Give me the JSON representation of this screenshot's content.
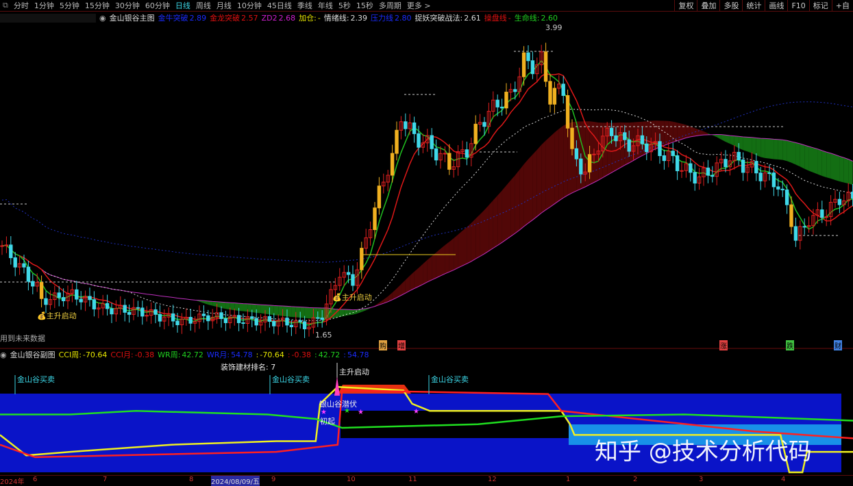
{
  "toolbar": {
    "periods": [
      "分时",
      "1分钟",
      "5分钟",
      "15分钟",
      "30分钟",
      "60分钟",
      "日线",
      "周线",
      "月线",
      "10分钟",
      "45日线",
      "季线",
      "年线",
      "5秒",
      "15秒",
      "多周期",
      "更多 >"
    ],
    "active_period": "日线",
    "right_buttons": [
      "复权",
      "叠加",
      "多股",
      "统计",
      "画线",
      "F10",
      "标记",
      "+自"
    ]
  },
  "main_legend": {
    "title": "金山银谷主图",
    "items": [
      {
        "label": "金牛突破",
        "value": "2.89",
        "color": "#1a2cff"
      },
      {
        "label": "金龙突破",
        "value": "2.57",
        "color": "#e01010"
      },
      {
        "label": "ZD2",
        "value": "2.68",
        "color": "#d020d0"
      },
      {
        "label": "加仓:",
        "value": "-",
        "color": "#e8e800"
      },
      {
        "label": "情绪线:",
        "value": "2.39",
        "color": "#ddd"
      },
      {
        "label": "压力线",
        "value": "2.80",
        "color": "#1a2cff"
      },
      {
        "label": "捉妖突破战法:",
        "value": "2.61",
        "color": "#ddd"
      },
      {
        "label": "操盘线",
        "value": "-",
        "color": "#e01010"
      },
      {
        "label": "生命线:",
        "value": "2.60",
        "color": "#20d020"
      }
    ]
  },
  "main_annotations": {
    "high": "3.99",
    "low": "1.65",
    "signal1": "主升启动",
    "signal2": "主升启动",
    "warning": "用到未来数据"
  },
  "badges": [
    {
      "text": "购",
      "color": "#e0a040"
    },
    {
      "text": "增",
      "color": "#e04040"
    },
    {
      "text": "涨",
      "color": "#e04040"
    },
    {
      "text": "跌",
      "color": "#40c040"
    },
    {
      "text": "财",
      "color": "#4080e0"
    }
  ],
  "sub_legend": {
    "title": "金山银谷副图",
    "items": [
      {
        "label": "CCI周:",
        "value": "-70.64",
        "color": "#e8e800"
      },
      {
        "label": "CCI月:",
        "value": "-0.38",
        "color": "#e01010"
      },
      {
        "label": "WR周:",
        "value": "42.72",
        "color": "#20d020"
      },
      {
        "label": "WR月:",
        "value": "54.78",
        "color": "#1a2cff"
      },
      {
        "label": ":",
        "value": "-70.64",
        "color": "#e8e800"
      },
      {
        "label": ":",
        "value": "-0.38",
        "color": "#e01010"
      },
      {
        "label": ":",
        "value": "42.72",
        "color": "#20d020"
      },
      {
        "label": ":",
        "value": "54.78",
        "color": "#1a2cff"
      }
    ],
    "rank": "装饰建材排名: 7",
    "buy_sell": "金山谷买卖",
    "start": "主升启动",
    "latent": "银山谷潜伏",
    "initial": "初起",
    "gold_valley": "金山谷买卖"
  },
  "x_axis": {
    "labels": [
      "2024年",
      "6",
      "7",
      "8",
      "2024/08/09/五",
      "9",
      "10",
      "11",
      "12",
      "1",
      "2",
      "3",
      "4"
    ]
  },
  "watermark": "知乎 @技术分析代码",
  "chart_data": {
    "type": "candlestick",
    "price_range": [
      1.65,
      3.99
    ],
    "close_waypoints": [
      [
        0,
        2.32
      ],
      [
        8,
        2.0
      ],
      [
        9,
        1.9
      ],
      [
        16,
        1.95
      ],
      [
        23,
        1.84
      ],
      [
        31,
        1.82
      ],
      [
        41,
        1.74
      ],
      [
        47,
        1.78
      ],
      [
        55,
        1.75
      ],
      [
        63,
        1.74
      ],
      [
        70,
        1.71
      ],
      [
        73,
        1.79
      ],
      [
        77,
        2.11
      ],
      [
        80,
        2.05
      ],
      [
        83,
        2.37
      ],
      [
        86,
        2.73
      ],
      [
        89,
        3.0
      ],
      [
        91,
        3.31
      ],
      [
        94,
        3.15
      ],
      [
        97,
        3.1
      ],
      [
        102,
        2.94
      ],
      [
        106,
        3.05
      ],
      [
        109,
        3.26
      ],
      [
        113,
        3.41
      ],
      [
        116,
        3.47
      ],
      [
        119,
        3.73
      ],
      [
        122,
        3.7
      ],
      [
        123,
        3.73
      ],
      [
        125,
        3.47
      ],
      [
        128,
        3.52
      ],
      [
        130,
        3.0
      ],
      [
        133,
        2.89
      ],
      [
        136,
        3.1
      ],
      [
        139,
        3.2
      ],
      [
        142,
        3.1
      ],
      [
        147,
        3.1
      ],
      [
        152,
        3.0
      ],
      [
        156,
        2.89
      ],
      [
        159,
        2.84
      ],
      [
        164,
        2.94
      ],
      [
        166,
        3.0
      ],
      [
        169,
        2.94
      ],
      [
        172,
        2.89
      ],
      [
        177,
        2.79
      ],
      [
        180,
        2.52
      ],
      [
        181,
        2.37
      ],
      [
        184,
        2.52
      ],
      [
        188,
        2.58
      ],
      [
        191,
        2.68
      ]
    ],
    "sub_series": [
      {
        "name": "CCI周",
        "color": "#f0f020",
        "points": [
          [
            0,
            42
          ],
          [
            6,
            19
          ],
          [
            16,
            23
          ],
          [
            39,
            31
          ],
          [
            63,
            35
          ],
          [
            72,
            35
          ],
          [
            73,
            77
          ],
          [
            77,
            96
          ],
          [
            92,
            92
          ],
          [
            94,
            77
          ],
          [
            98,
            69
          ],
          [
            128,
            69
          ],
          [
            130,
            54
          ],
          [
            131,
            42
          ],
          [
            178,
            42
          ],
          [
            180,
            0
          ],
          [
            183,
            0
          ],
          [
            184,
            23
          ],
          [
            195,
            23
          ]
        ]
      },
      {
        "name": "CCI月",
        "color": "#ff2020",
        "points": [
          [
            0,
            31
          ],
          [
            8,
            17
          ],
          [
            63,
            23
          ],
          [
            77,
            31
          ],
          [
            78,
            92
          ],
          [
            125,
            88
          ],
          [
            128,
            69
          ],
          [
            172,
            46
          ],
          [
            195,
            38
          ]
        ]
      },
      {
        "name": "WR周",
        "color": "#20e020",
        "points": [
          [
            0,
            65
          ],
          [
            16,
            65
          ],
          [
            31,
            69
          ],
          [
            61,
            65
          ],
          [
            72,
            60
          ],
          [
            78,
            50
          ],
          [
            109,
            54
          ],
          [
            128,
            63
          ],
          [
            156,
            65
          ],
          [
            195,
            58
          ]
        ]
      }
    ]
  }
}
